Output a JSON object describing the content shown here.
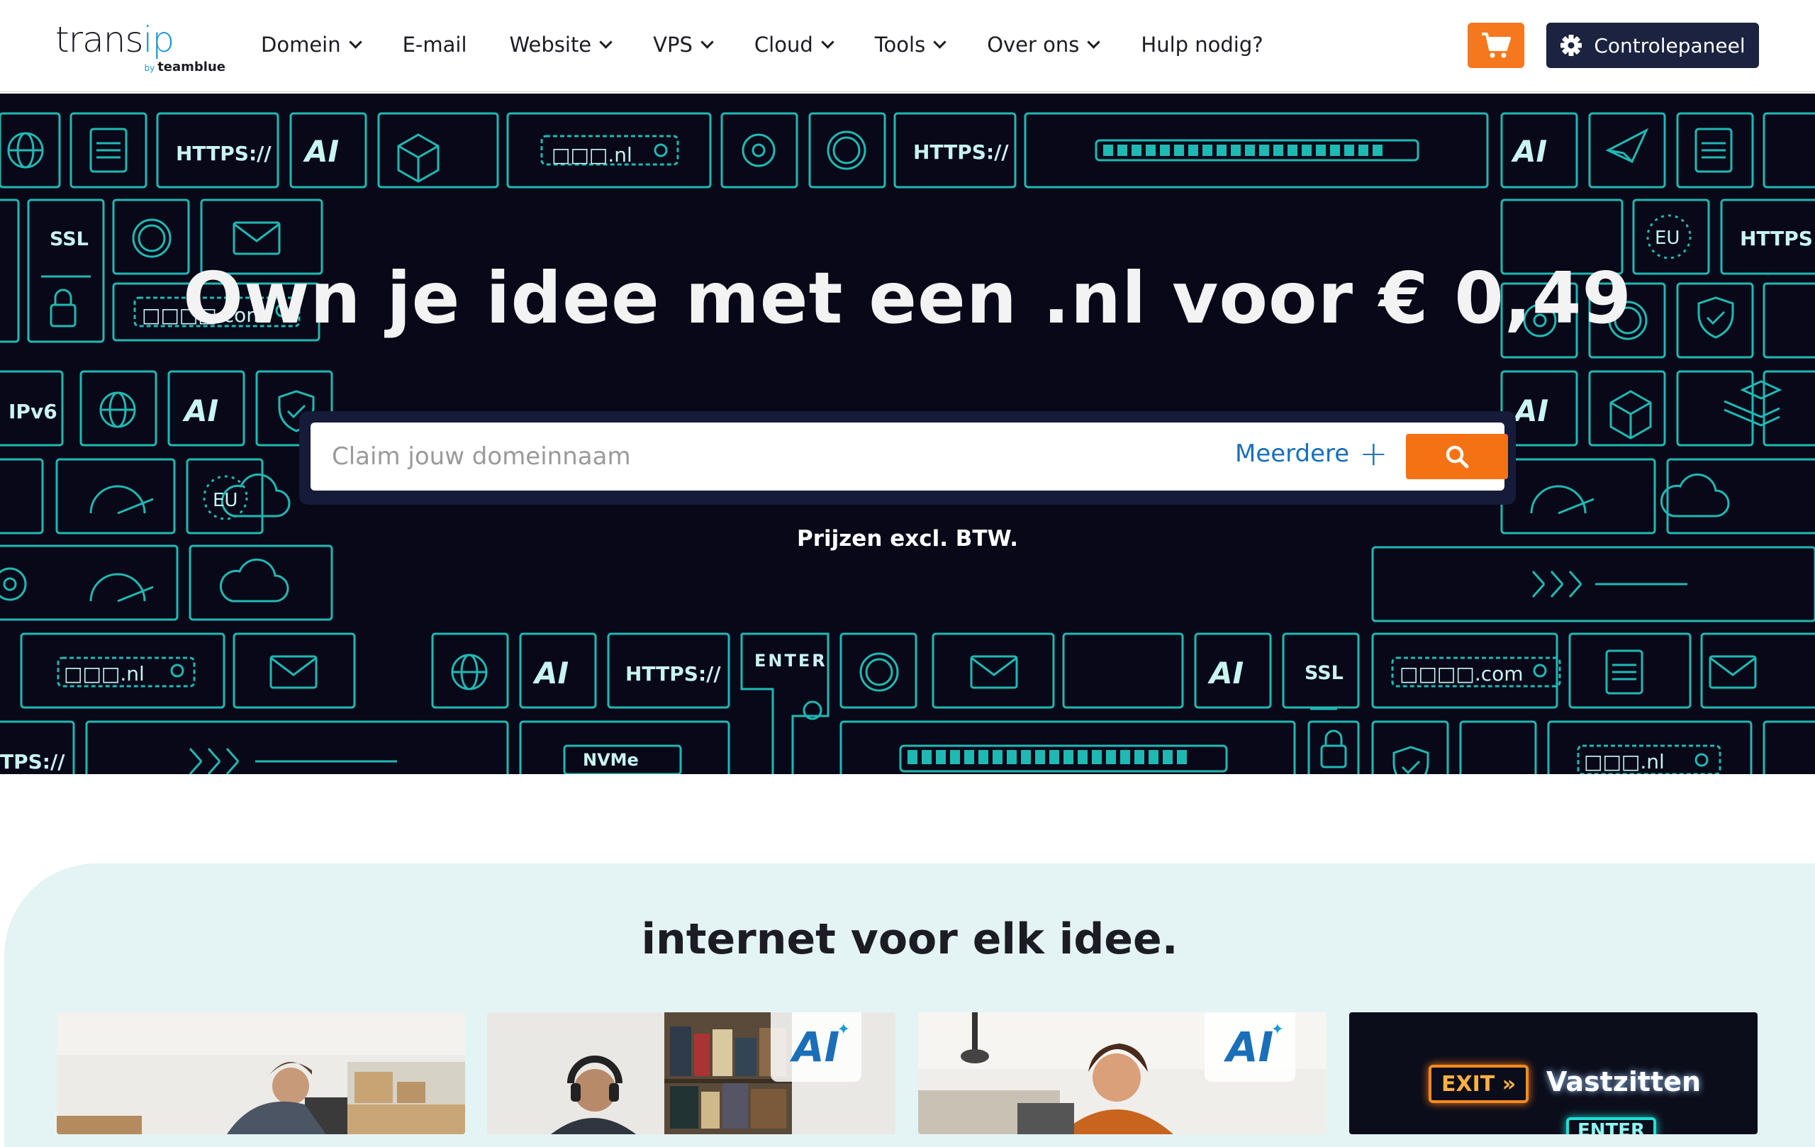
{
  "header": {
    "logo": {
      "main_a": "trans",
      "main_b": "ip",
      "by": "by",
      "sub": "teamblue"
    },
    "nav": [
      {
        "label": "Domein",
        "has_dropdown": true
      },
      {
        "label": "E-mail",
        "has_dropdown": false
      },
      {
        "label": "Website",
        "has_dropdown": true
      },
      {
        "label": "VPS",
        "has_dropdown": true
      },
      {
        "label": "Cloud",
        "has_dropdown": true
      },
      {
        "label": "Tools",
        "has_dropdown": true
      },
      {
        "label": "Over ons",
        "has_dropdown": true
      },
      {
        "label": "Hulp nodig?",
        "has_dropdown": false
      }
    ],
    "cart_icon": "shopping-cart-icon",
    "control_panel_label": "Controlepaneel",
    "control_panel_icon": "gear-icon"
  },
  "hero": {
    "title": "Own je idee met een .nl voor € 0,49",
    "search": {
      "placeholder": "Claim jouw domeinnaam",
      "value": "",
      "multiple_label": "Meerdere",
      "multiple_icon": "plus-icon",
      "button_icon": "search-icon"
    },
    "price_note": "Prijzen excl. BTW.",
    "background_tiles": {
      "https": "HTTPS://",
      "https_cut_right": "HTTPS:",
      "https_cut_left": "TPS://",
      "ssl": "SSL",
      "ipv6": "IPv6",
      "eu": "EU",
      "enter": "ENTER",
      "nvme": "NVMe",
      "ai": "AI",
      "domain_nl": "□□□.nl",
      "domain_com": "□□□□.com",
      "back": "<<<"
    }
  },
  "section": {
    "title": "internet voor elk idee.",
    "cards": [
      {
        "badge": ""
      },
      {
        "badge": "AI"
      },
      {
        "badge": "AI"
      },
      {
        "exit_sign": "EXIT",
        "exit_arrows": "»",
        "label": "Vastzitten",
        "enter_sign": "ENTER"
      }
    ]
  },
  "colors": {
    "accent_orange": "#f57214",
    "navy": "#1b2340",
    "hero_bg": "#080818",
    "neon_cyan": "#1fb9b4",
    "section_bg": "#e4f4f4",
    "link_blue": "#1b6fb8"
  }
}
